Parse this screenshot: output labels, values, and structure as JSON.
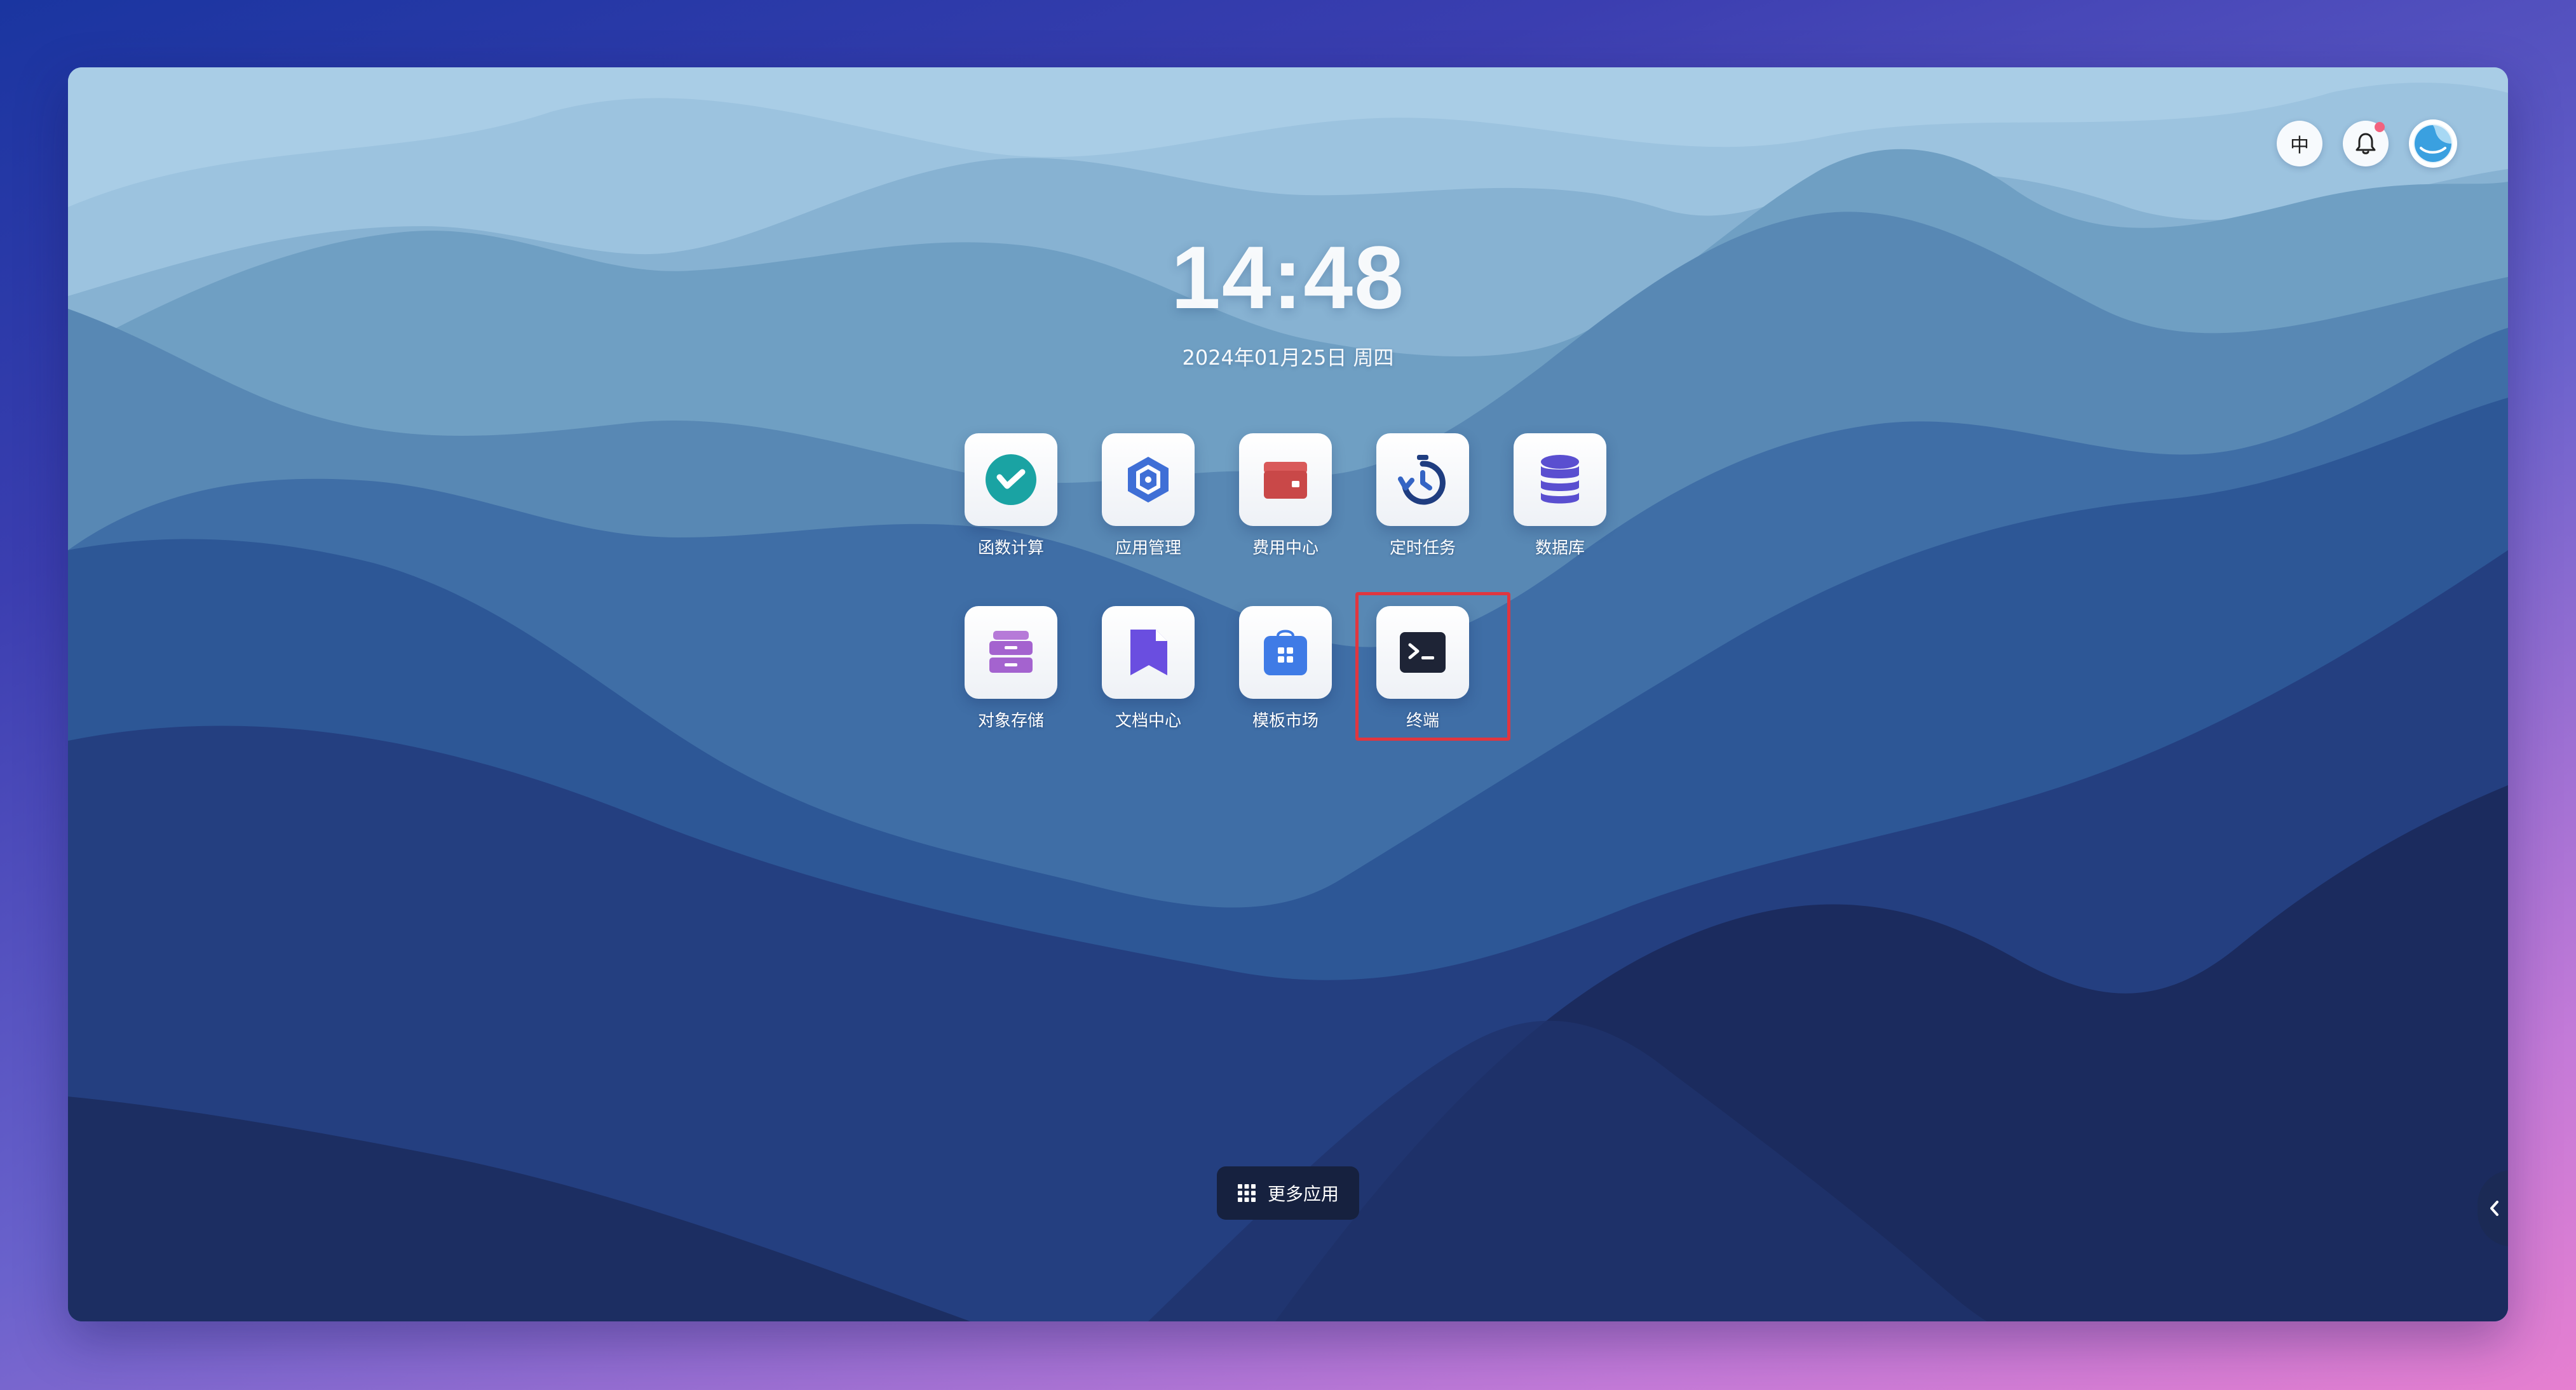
{
  "clock": {
    "time": "14:48",
    "date": "2024年01月25日 周四"
  },
  "header": {
    "lang_button": "中",
    "notification_icon": "bell-icon",
    "has_unread_notification": true,
    "avatar_icon": "avatar-logo"
  },
  "apps": [
    {
      "label": "函数计算",
      "icon": "function-icon",
      "color": "#1aa3a3"
    },
    {
      "label": "应用管理",
      "icon": "app-manage-icon",
      "color": "#3f6fd6"
    },
    {
      "label": "费用中心",
      "icon": "wallet-icon",
      "color": "#d95a5a"
    },
    {
      "label": "定时任务",
      "icon": "timer-icon",
      "color": "#3464c4"
    },
    {
      "label": "数据库",
      "icon": "database-icon",
      "color": "#5a4fd0"
    },
    {
      "label": "对象存储",
      "icon": "storage-icon",
      "color": "#a463cf"
    },
    {
      "label": "文档中心",
      "icon": "document-icon",
      "color": "#6a4ee0"
    },
    {
      "label": "模板市场",
      "icon": "template-market-icon",
      "color": "#3f7be6"
    },
    {
      "label": "终端",
      "icon": "terminal-icon",
      "color": "#1e2436"
    }
  ],
  "highlighted_app": "终端",
  "more_apps": {
    "label": "更多应用",
    "icon": "grid-icon"
  },
  "side_toggle": {
    "icon": "chevron-left-icon"
  }
}
